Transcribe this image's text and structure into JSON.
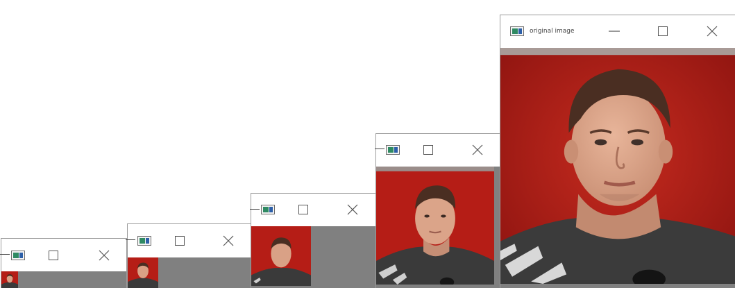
{
  "windows": [
    {
      "title": "",
      "icon": "opencv-window-icon",
      "controls": [
        "minimize-button",
        "maximize-button",
        "close-button"
      ]
    },
    {
      "title": "",
      "icon": "opencv-window-icon",
      "controls": [
        "minimize-button",
        "maximize-button",
        "close-button"
      ]
    },
    {
      "title": "",
      "icon": "opencv-window-icon",
      "controls": [
        "minimize-button",
        "maximize-button",
        "close-button"
      ]
    },
    {
      "title": "",
      "icon": "opencv-window-icon",
      "controls": [
        "minimize-button",
        "maximize-button",
        "close-button"
      ]
    },
    {
      "title": "original image",
      "icon": "opencv-window-icon",
      "controls": [
        "minimize-button",
        "maximize-button",
        "close-button"
      ]
    }
  ],
  "colors": {
    "client_background": "#808080",
    "photo_backdrop": "#b51d16",
    "shirt": "#3a3a3a"
  }
}
